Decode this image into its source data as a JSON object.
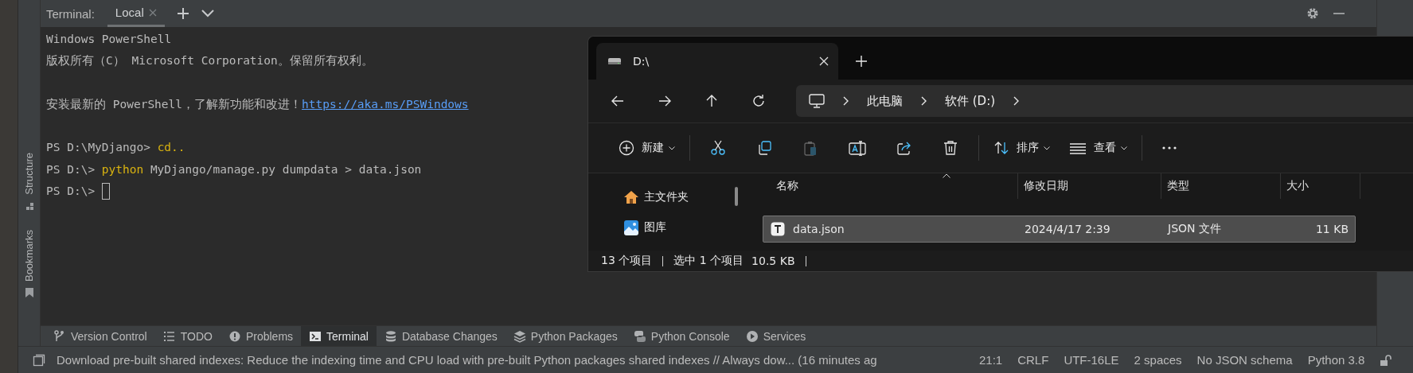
{
  "ide": {
    "terminal": {
      "title": "Terminal:",
      "tabs": [
        {
          "label": "Local",
          "selected": true
        }
      ],
      "cursor": true,
      "lines": [
        {
          "kind": "output",
          "segments": [
            {
              "kind": "plain",
              "text": "Windows PowerShell"
            }
          ]
        },
        {
          "kind": "output",
          "segments": [
            {
              "kind": "plain",
              "text": "版权所有（C） Microsoft Corporation。保留所有权利。"
            }
          ]
        },
        {
          "kind": "blank"
        },
        {
          "kind": "output",
          "segments": [
            {
              "kind": "plain",
              "text": "安装最新的 PowerShell，了解新功能和改进！"
            },
            {
              "kind": "link",
              "text": "https://aka.ms/PSWindows"
            }
          ]
        },
        {
          "kind": "blank"
        },
        {
          "kind": "prompt",
          "segments": [
            {
              "kind": "plain",
              "text": "PS D:\\MyDjango>"
            },
            {
              "kind": "keyword",
              "text": "cd.."
            }
          ]
        },
        {
          "kind": "prompt",
          "segments": [
            {
              "kind": "plain",
              "text": "PS D:\\>"
            },
            {
              "kind": "keyword",
              "text": "python"
            },
            {
              "kind": "plain",
              "text": "MyDjango/manage.py dumpdata > data.json"
            }
          ]
        },
        {
          "kind": "prompt",
          "segments": [
            {
              "kind": "plain",
              "text": "PS D:\\>"
            }
          ]
        }
      ]
    },
    "left_toolbar": [
      {
        "kind": "structure",
        "label": "Structure"
      },
      {
        "kind": "bookmarks",
        "label": "Bookmarks"
      }
    ],
    "bottom_tabs": [
      {
        "kind": "vcs",
        "label": "Version Control",
        "selected": false
      },
      {
        "kind": "todo",
        "label": "TODO",
        "selected": false
      },
      {
        "kind": "problems",
        "label": "Problems",
        "selected": false
      },
      {
        "kind": "terminal",
        "label": "Terminal",
        "selected": true
      },
      {
        "kind": "database",
        "label": "Database Changes",
        "selected": false
      },
      {
        "kind": "packages",
        "label": "Python Packages",
        "selected": false
      },
      {
        "kind": "console",
        "label": "Python Console",
        "selected": false
      },
      {
        "kind": "services",
        "label": "Services",
        "selected": false
      }
    ],
    "status_bar": {
      "message": "Download pre-built shared indexes: Reduce the indexing time and CPU load with pre-built Python packages shared indexes // Always dow... (16 minutes ag",
      "items": [
        "21:1",
        "CRLF",
        "UTF-16LE",
        "2 spaces",
        "No JSON schema",
        "Python 3.8"
      ]
    }
  },
  "explorer": {
    "tabs": [
      {
        "label": "D:\\",
        "selected": true
      }
    ],
    "breadcrumb": [
      "此电脑",
      "软件 (D:)"
    ],
    "commands": [
      {
        "kind": "new",
        "label": "新建",
        "disabled": false
      },
      {
        "kind": "cut",
        "disabled": false
      },
      {
        "kind": "copy",
        "disabled": false
      },
      {
        "kind": "paste",
        "disabled": true
      },
      {
        "kind": "rename",
        "disabled": false
      },
      {
        "kind": "share",
        "disabled": false
      },
      {
        "kind": "delete",
        "disabled": false
      },
      {
        "kind": "sort",
        "label": "排序",
        "disabled": false
      },
      {
        "kind": "view",
        "label": "查看",
        "disabled": false
      },
      {
        "kind": "more",
        "disabled": false
      }
    ],
    "sidebar": [
      {
        "kind": "home",
        "label": "主文件夹"
      },
      {
        "kind": "gallery",
        "label": "图库"
      }
    ],
    "columns": [
      "名称",
      "修改日期",
      "类型",
      "大小"
    ],
    "rows": [
      {
        "name": "data.json",
        "modified": "2024/4/17 2:39",
        "type": "JSON 文件",
        "size": "11 KB",
        "selected": true
      }
    ],
    "status": {
      "count": "13 个项目",
      "selection": "选中 1 个项目",
      "size": "10.5 KB"
    }
  }
}
